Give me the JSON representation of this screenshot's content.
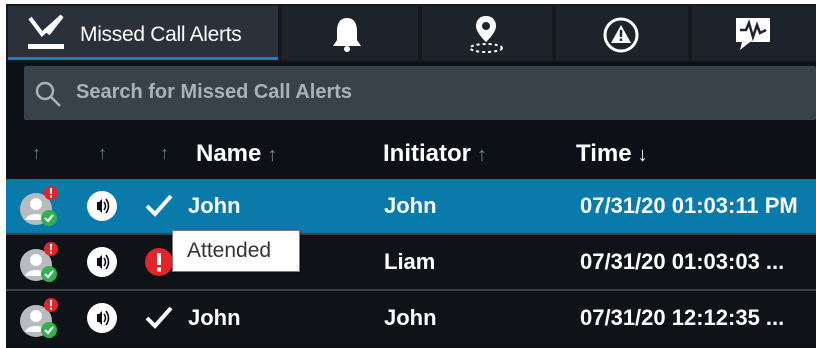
{
  "tabs": {
    "active_label": "Missed Call Alerts",
    "items": [
      {
        "icon": "missed-call-icon",
        "label": "Missed Call Alerts"
      },
      {
        "icon": "bell-icon"
      },
      {
        "icon": "location-pin-icon"
      },
      {
        "icon": "warning-triangle-icon"
      },
      {
        "icon": "voice-message-icon"
      }
    ]
  },
  "search": {
    "placeholder": "Search for Missed Call Alerts"
  },
  "columns": {
    "name": "Name",
    "initiator": "Initiator",
    "time": "Time",
    "sorted_by": "Time",
    "sort_direction": "descending"
  },
  "rows": [
    {
      "name": "John",
      "initiator": "John",
      "time": "07/31/20 01:03:11 PM",
      "status": "attended",
      "selected": true
    },
    {
      "name": "",
      "initiator": "Liam",
      "time": "07/31/20 01:03:03 ...",
      "status": "unattended",
      "selected": false
    },
    {
      "name": "John",
      "initiator": "John",
      "time": "07/31/20 12:12:35 ...",
      "status": "attended",
      "selected": false
    }
  ],
  "tooltip": {
    "text": "Attended"
  },
  "colors": {
    "panel": "#0d1117",
    "selected_row": "#0a7aab",
    "search_bg": "#39414b",
    "alert_red": "#e3242b",
    "ok_green": "#2fb24c"
  }
}
